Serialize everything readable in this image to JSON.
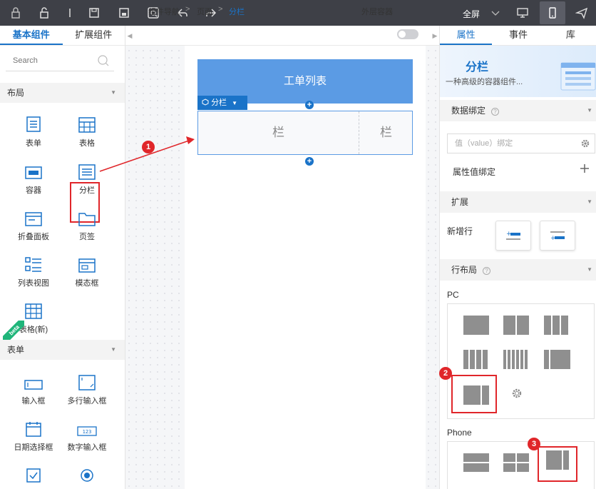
{
  "toolbar": {
    "fullscreen_label": "全屏",
    "icons": [
      "lock-icon",
      "unlock-icon",
      "divider",
      "save-icon",
      "save-as-icon",
      "preview-icon",
      "undo-icon",
      "redo-icon",
      "chevron-down-icon",
      "desktop-icon",
      "mobile-icon",
      "send-icon"
    ]
  },
  "left_panel": {
    "tabs": [
      "基本组件",
      "扩展组件"
    ],
    "search_placeholder": "Search",
    "sections": [
      {
        "title": "布局",
        "items": [
          "表单",
          "表格",
          "容器",
          "分栏",
          "折叠面板",
          "页签",
          "列表视图",
          "模态框",
          "表格(新)"
        ]
      },
      {
        "title": "表单",
        "items": [
          "输入框",
          "多行输入框",
          "日期选择框",
          "数字输入框"
        ]
      }
    ],
    "beta_label": "beta"
  },
  "canvas": {
    "breadcrumb": [
      "组件导航",
      "页面",
      "分栏"
    ],
    "outer_container_label": "外层容器",
    "header_title": "工单列表",
    "selected_tag": "分栏",
    "columns": [
      "栏",
      "栏"
    ]
  },
  "markers": [
    "1",
    "2",
    "3"
  ],
  "right_panel": {
    "tabs": [
      "属性",
      "事件",
      "库"
    ],
    "title": "分栏",
    "subtitle": "一种高级的容器组件...",
    "data_binding_section": "数据绑定",
    "value_binding_placeholder": "值（value）绑定",
    "attribute_binding_label": "属性值绑定",
    "extension_section": "扩展",
    "new_row_label": "新增行",
    "row_layout_section": "行布局",
    "pc_label": "PC",
    "phone_label": "Phone"
  },
  "colors": {
    "accent": "#1a73c8",
    "toolbar_bg": "#3e4047",
    "header_blue": "#5b9be4",
    "highlight_red": "#e0262a"
  }
}
